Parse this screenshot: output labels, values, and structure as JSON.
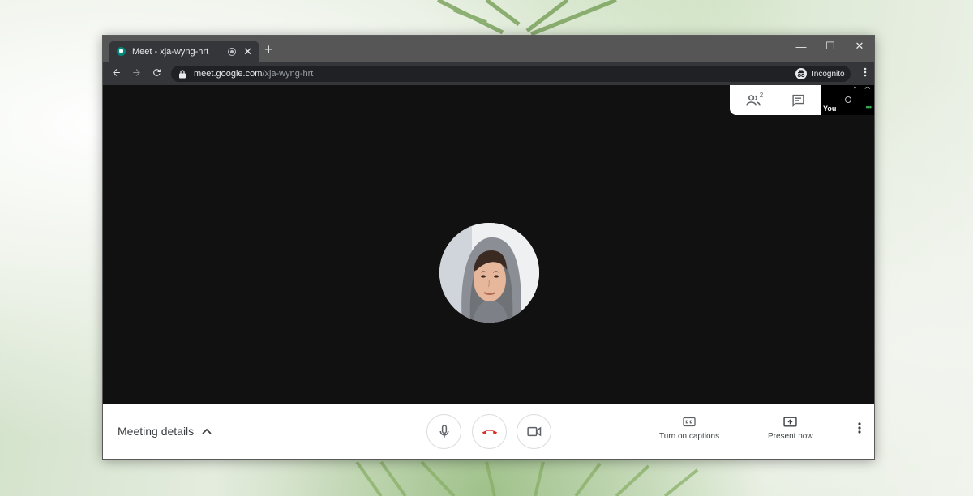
{
  "browser": {
    "tab": {
      "title": "Meet - xja-wyng-hrt",
      "favicon": "google-meet-icon",
      "close": "✕"
    },
    "new_tab": "+",
    "window_controls": {
      "minimize": "—",
      "maximize": "☐",
      "close": "✕"
    },
    "url": {
      "host": "meet.google.com",
      "path": "/xja-wyng-hrt"
    },
    "profile": {
      "label": "Incognito",
      "icon": "incognito-icon"
    }
  },
  "meet": {
    "participants_count": "2",
    "self_tile": {
      "label": "You"
    },
    "bottom_bar": {
      "meeting_details": "Meeting details",
      "captions": "Turn on captions",
      "present": "Present now"
    }
  },
  "colors": {
    "hangup_red": "#d93025",
    "self_dots_green": "#34a853",
    "stage": "#111111"
  }
}
